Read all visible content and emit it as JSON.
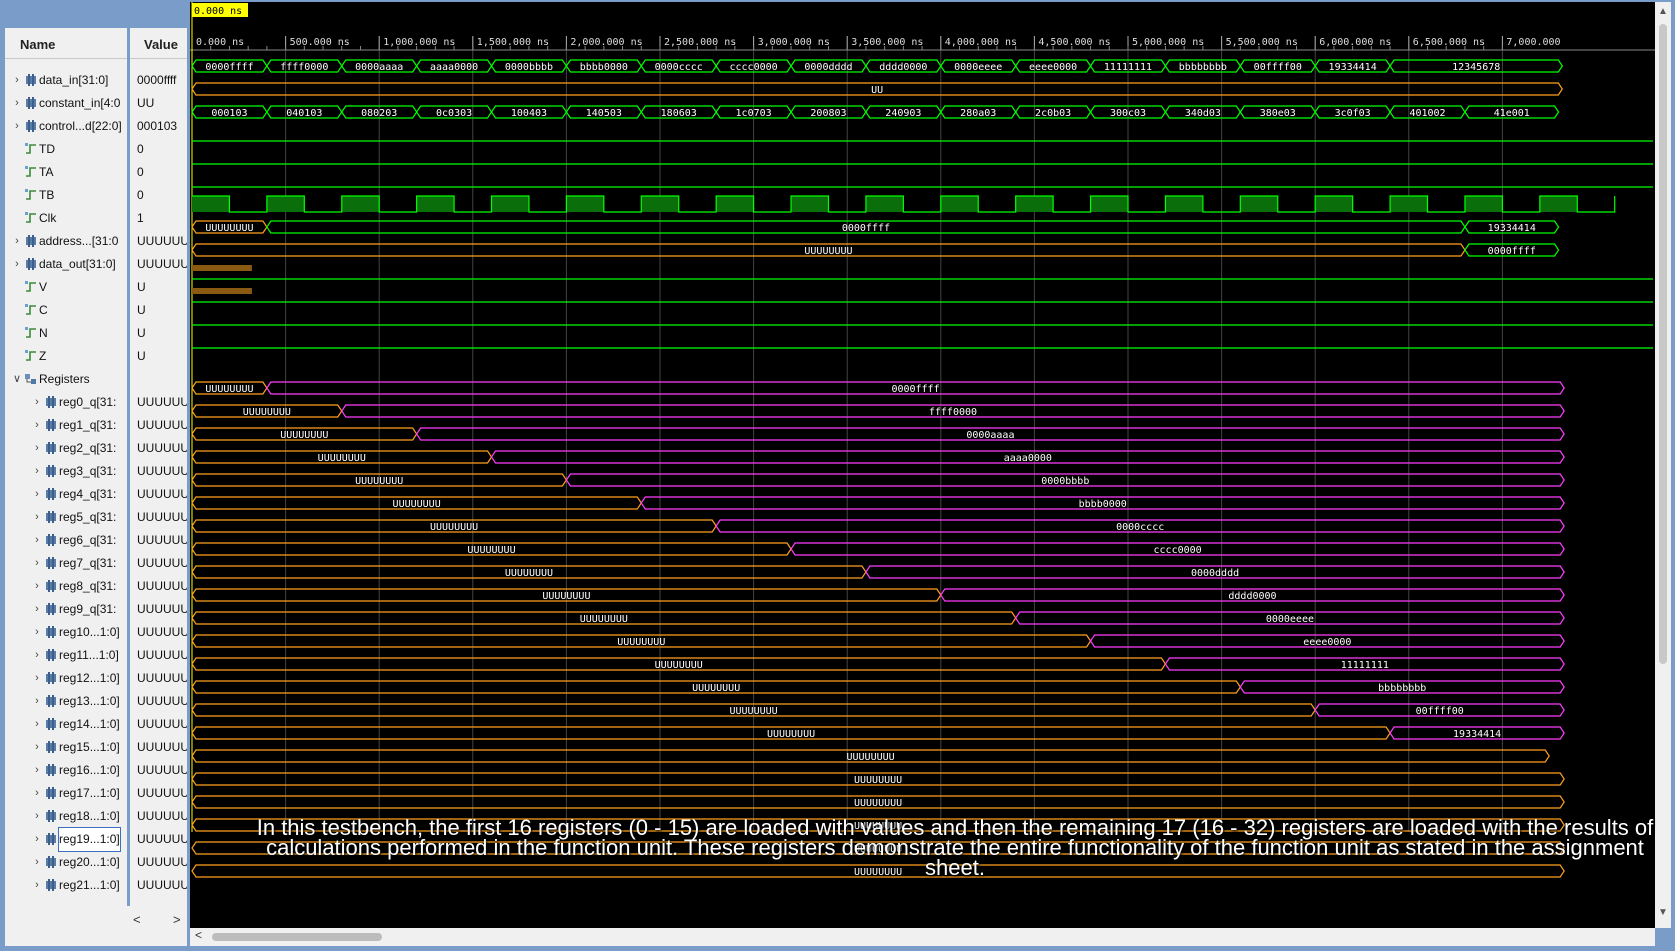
{
  "cursor_time": "0.000 ns",
  "columns": {
    "name": "Name",
    "value": "Value"
  },
  "colors": {
    "bus": "#00ff00",
    "unknown": "#ff9f1c",
    "register": "#ff3cff",
    "grid": "#444444",
    "cursor_bg": "#ffff00",
    "text": "#ffffff"
  },
  "time_labels": [
    "0.000 ns",
    "500.000 ns",
    "1,000.000 ns",
    "1,500.000 ns",
    "2,000.000 ns",
    "2,500.000 ns",
    "3,000.000 ns",
    "3,500.000 ns",
    "4,000.000 ns",
    "4,500.000 ns",
    "5,000.000 ns",
    "5,500.000 ns",
    "6,000.000 ns",
    "6,500.000 ns",
    "7,000.000"
  ],
  "signals": [
    {
      "name": "data_in[31:0]",
      "value": "0000ffff",
      "type": "bus",
      "expand": true,
      "icon": "bus-icon"
    },
    {
      "name": "constant_in[4:0",
      "value": "UU",
      "type": "bus",
      "expand": true,
      "icon": "bus-icon"
    },
    {
      "name": "control...d[22:0]",
      "value": "000103",
      "type": "bus",
      "expand": true,
      "icon": "bus-icon"
    },
    {
      "name": "TD",
      "value": "0",
      "type": "bit",
      "icon": "bit-icon"
    },
    {
      "name": "TA",
      "value": "0",
      "type": "bit",
      "icon": "bit-icon"
    },
    {
      "name": "TB",
      "value": "0",
      "type": "bit",
      "icon": "bit-icon"
    },
    {
      "name": "Clk",
      "value": "1",
      "type": "bit",
      "icon": "bit-icon"
    },
    {
      "name": "address...[31:0",
      "value": "UUUUUU",
      "type": "bus",
      "expand": true,
      "icon": "bus-icon"
    },
    {
      "name": "data_out[31:0]",
      "value": "UUUUUU",
      "type": "bus",
      "expand": true,
      "icon": "bus-icon"
    },
    {
      "name": "V",
      "value": "U",
      "type": "bit",
      "icon": "bit-icon"
    },
    {
      "name": "C",
      "value": "U",
      "type": "bit",
      "icon": "bit-icon"
    },
    {
      "name": "N",
      "value": "U",
      "type": "bit",
      "icon": "bit-icon"
    },
    {
      "name": "Z",
      "value": "U",
      "type": "bit",
      "icon": "bit-icon"
    },
    {
      "name": "Registers",
      "value": "",
      "type": "group",
      "expand": true,
      "icon": "group-icon"
    },
    {
      "name": "reg0_q[31:",
      "value": "UUUUUU",
      "type": "bus",
      "expand": true,
      "icon": "bus-icon",
      "indent": true
    },
    {
      "name": "reg1_q[31:",
      "value": "UUUUUU",
      "type": "bus",
      "expand": true,
      "icon": "bus-icon",
      "indent": true
    },
    {
      "name": "reg2_q[31:",
      "value": "UUUUUU",
      "type": "bus",
      "expand": true,
      "icon": "bus-icon",
      "indent": true
    },
    {
      "name": "reg3_q[31:",
      "value": "UUUUUU",
      "type": "bus",
      "expand": true,
      "icon": "bus-icon",
      "indent": true
    },
    {
      "name": "reg4_q[31:",
      "value": "UUUUUU",
      "type": "bus",
      "expand": true,
      "icon": "bus-icon",
      "indent": true
    },
    {
      "name": "reg5_q[31:",
      "value": "UUUUUU",
      "type": "bus",
      "expand": true,
      "icon": "bus-icon",
      "indent": true
    },
    {
      "name": "reg6_q[31:",
      "value": "UUUUUU",
      "type": "bus",
      "expand": true,
      "icon": "bus-icon",
      "indent": true
    },
    {
      "name": "reg7_q[31:",
      "value": "UUUUUU",
      "type": "bus",
      "expand": true,
      "icon": "bus-icon",
      "indent": true
    },
    {
      "name": "reg8_q[31:",
      "value": "UUUUUU",
      "type": "bus",
      "expand": true,
      "icon": "bus-icon",
      "indent": true
    },
    {
      "name": "reg9_q[31:",
      "value": "UUUUUU",
      "type": "bus",
      "expand": true,
      "icon": "bus-icon",
      "indent": true
    },
    {
      "name": "reg10...1:0]",
      "value": "UUUUUU",
      "type": "bus",
      "expand": true,
      "icon": "bus-icon",
      "indent": true
    },
    {
      "name": "reg11...1:0]",
      "value": "UUUUUU",
      "type": "bus",
      "expand": true,
      "icon": "bus-icon",
      "indent": true
    },
    {
      "name": "reg12...1:0]",
      "value": "UUUUUU",
      "type": "bus",
      "expand": true,
      "icon": "bus-icon",
      "indent": true
    },
    {
      "name": "reg13...1:0]",
      "value": "UUUUUU",
      "type": "bus",
      "expand": true,
      "icon": "bus-icon",
      "indent": true
    },
    {
      "name": "reg14...1:0]",
      "value": "UUUUUU",
      "type": "bus",
      "expand": true,
      "icon": "bus-icon",
      "indent": true
    },
    {
      "name": "reg15...1:0]",
      "value": "UUUUUU",
      "type": "bus",
      "expand": true,
      "icon": "bus-icon",
      "indent": true
    },
    {
      "name": "reg16...1:0]",
      "value": "UUUUUU",
      "type": "bus",
      "expand": true,
      "icon": "bus-icon",
      "indent": true
    },
    {
      "name": "reg17...1:0]",
      "value": "UUUUUU",
      "type": "bus",
      "expand": true,
      "icon": "bus-icon",
      "indent": true
    },
    {
      "name": "reg18...1:0]",
      "value": "UUUUUU",
      "type": "bus",
      "expand": true,
      "icon": "bus-icon",
      "indent": true
    },
    {
      "name": "reg19...1:0]",
      "value": "UUUUUU",
      "type": "bus",
      "expand": true,
      "icon": "bus-icon",
      "indent": true,
      "selected": true
    },
    {
      "name": "reg20...1:0]",
      "value": "UUUUUU",
      "type": "bus",
      "expand": true,
      "icon": "bus-icon",
      "indent": true
    },
    {
      "name": "reg21...1:0]",
      "value": "UUUUUU",
      "type": "bus",
      "expand": true,
      "icon": "bus-icon",
      "indent": true
    }
  ],
  "waves": {
    "data_in": [
      "0000ffff",
      "ffff0000",
      "0000aaaa",
      "aaaa0000",
      "0000bbbb",
      "bbbb0000",
      "0000cccc",
      "cccc0000",
      "0000dddd",
      "dddd0000",
      "0000eeee",
      "eeee0000",
      "11111111",
      "bbbbbbbb",
      "00ffff00",
      "19334414",
      "12345678"
    ],
    "constant_in": "UU",
    "control": [
      "000103",
      "040103",
      "080203",
      "0c0303",
      "100403",
      "140503",
      "180603",
      "1c0703",
      "200803",
      "240903",
      "280a03",
      "2c0b03",
      "300c03",
      "340d03",
      "380e03",
      "3c0f03",
      "401002",
      "41e001"
    ],
    "address": [
      "UUUUUUUU",
      "0000ffff",
      "19334414"
    ],
    "data_out": [
      "UUUUUUUU",
      "0000ffff"
    ],
    "reg_unknown": "UUUUUUUU",
    "reg_values": [
      "0000ffff",
      "ffff0000",
      "0000aaaa",
      "aaaa0000",
      "0000bbbb",
      "bbbb0000",
      "0000cccc",
      "cccc0000",
      "0000dddd",
      "dddd0000",
      "0000eeee",
      "eeee0000",
      "11111111",
      "bbbbbbbb",
      "00ffff00",
      "19334414"
    ]
  },
  "caption": "In this testbench, the first 16 registers (0 - 15) are loaded with values and then the remaining 17 (16 - 32) registers are loaded with the results of calculations performed in the function unit. These registers demonstrate the entire functionality of the function unit as stated in the assignment sheet."
}
